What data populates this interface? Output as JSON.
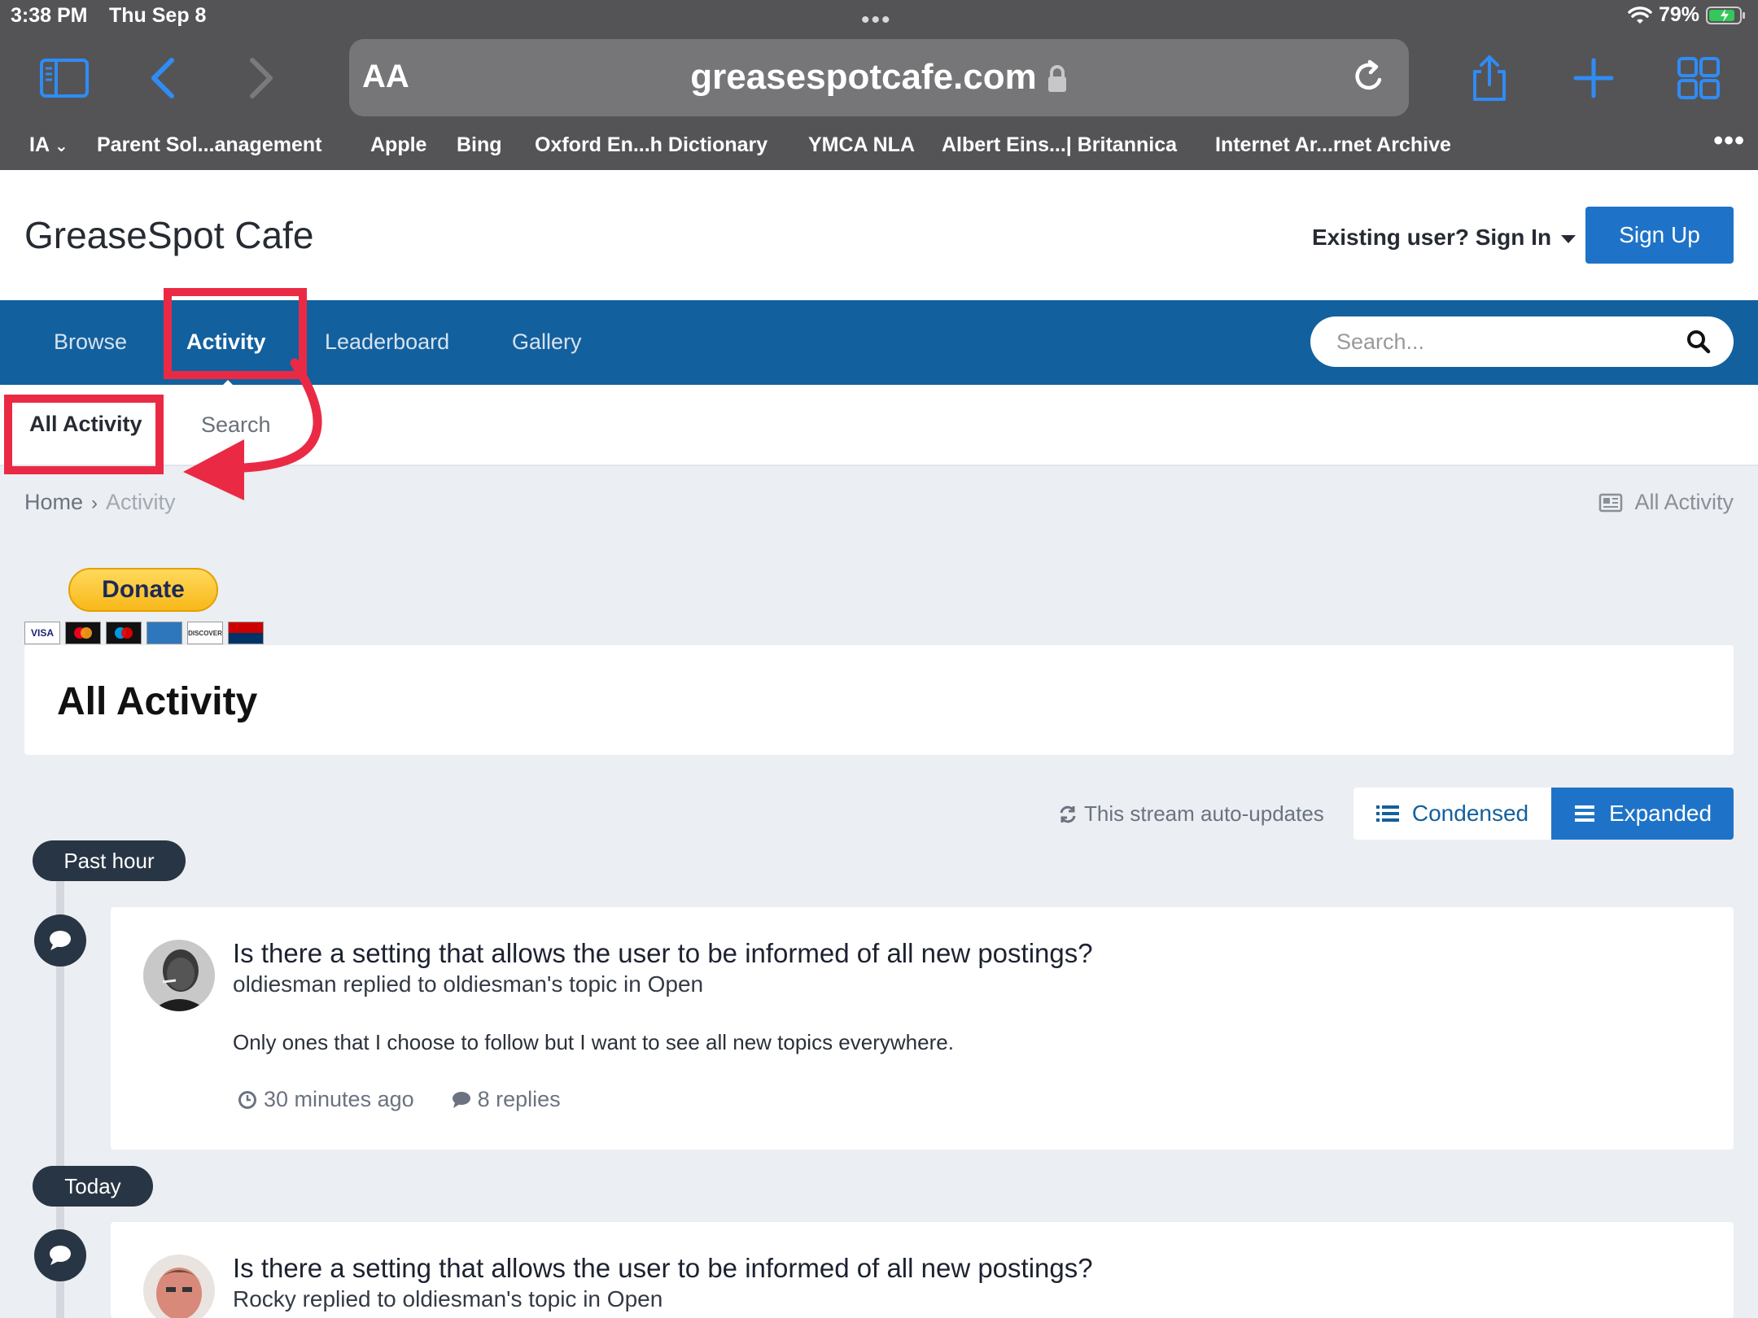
{
  "status_bar": {
    "time": "3:38 PM",
    "date": "Thu Sep 8",
    "battery": "79%"
  },
  "browser": {
    "text_size_label": "AA",
    "url": "greasespotcafe.com",
    "bookmarks": [
      "IA",
      "Parent Sol...anagement",
      "Apple",
      "Bing",
      "Oxford En...h Dictionary",
      "YMCA NLA",
      "Albert Eins...| Britannica",
      "Internet Ar...rnet Archive"
    ]
  },
  "header": {
    "site_title": "GreaseSpot Cafe",
    "signin_label": "Existing user? Sign In",
    "signup_label": "Sign Up"
  },
  "nav": {
    "items": [
      "Browse",
      "Activity",
      "Leaderboard",
      "Gallery"
    ],
    "search_placeholder": "Search..."
  },
  "subnav": {
    "items": [
      "All Activity",
      "Search"
    ]
  },
  "breadcrumb": {
    "home": "Home",
    "current": "Activity",
    "right_link": "All Activity"
  },
  "donate": {
    "label": "Donate",
    "cards": [
      "VISA",
      "",
      "",
      "",
      "DISCOVER",
      ""
    ]
  },
  "page": {
    "title": "All Activity"
  },
  "stream": {
    "auto_update_text": "This stream auto-updates",
    "condensed_label": "Condensed",
    "expanded_label": "Expanded"
  },
  "groups": [
    {
      "label": "Past hour",
      "entries": [
        {
          "title": "Is there a setting that allows the user to be informed of all new postings?",
          "meta": "oldiesman replied to oldiesman's topic in Open",
          "snippet": "Only ones that I choose to follow but I want to see all new topics everywhere.",
          "time": "30 minutes ago",
          "replies": "8 replies"
        }
      ]
    },
    {
      "label": "Today",
      "entries": [
        {
          "title": "Is there a setting that allows the user to be informed of all new postings?",
          "meta": "Rocky replied to oldiesman's topic in Open"
        }
      ]
    }
  ],
  "colors": {
    "nav_blue": "#13609e",
    "button_blue": "#1e73c8",
    "annotation_red": "#ea2a45",
    "timeline_dark": "#283544"
  }
}
